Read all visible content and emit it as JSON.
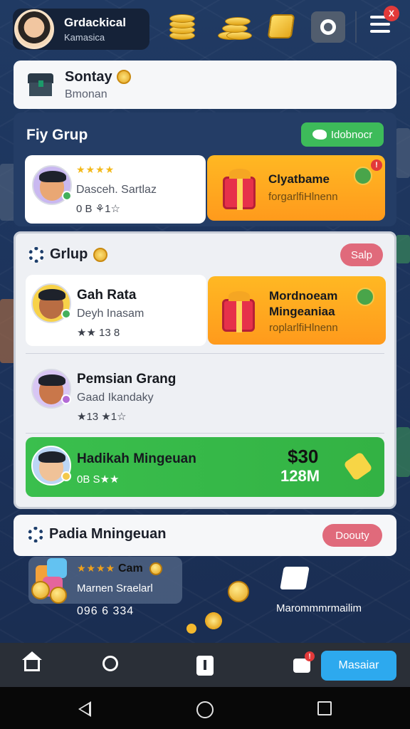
{
  "profile": {
    "name": "Grdackical",
    "subtitle": "Kamasica"
  },
  "top_bar": {
    "menu_badge": "X"
  },
  "sontay": {
    "title": "Sontay",
    "subtitle": "Bmonan"
  },
  "fiy_grup": {
    "title": "Fiy Grup",
    "action_label": "Idobnocr",
    "player": {
      "stars": "★★★★",
      "name": "Dasceh. Sartlaz",
      "meta": "0 B ⚘1☆"
    },
    "reward": {
      "title": "Clyatbame",
      "subtitle": "forgarlfiHlnenn",
      "badge": "!"
    }
  },
  "grup": {
    "title": "Grlup",
    "action_label": "Salp",
    "rows": [
      {
        "name": "Gah Rata",
        "sub": "Deyh Inasam",
        "meta": "★★ 13 8"
      },
      {
        "name": "Pemsian Grang",
        "sub": "Gaad Ikandaky",
        "meta": "★13 ★1☆"
      }
    ],
    "reward": {
      "line1": "Mordnoeam",
      "line2": "Mingeaniaa",
      "line3": "roplarlfiHlnenn"
    },
    "highlight": {
      "title": "Hadikah Mingeuan",
      "meta": "0B S★★",
      "amount": "$30",
      "amount_sub": "128M"
    }
  },
  "padia": {
    "title": "Padia Mningeuan",
    "action_label": "Doouty"
  },
  "bonus": {
    "stars": "★★★★",
    "title": "Cam",
    "subtitle": "Marnen Sraelarl",
    "code": "096 6 334",
    "caption": "Marommmrmailim"
  },
  "nav": {
    "cta_label": "Masaiar",
    "msg_badge": "!"
  },
  "colors": {
    "accent_blue": "#2da9ee",
    "accent_green": "#3dbb5a",
    "accent_orange": "#ff9a1c",
    "accent_pink": "#e06a7b",
    "panel_navy": "#243d66"
  }
}
